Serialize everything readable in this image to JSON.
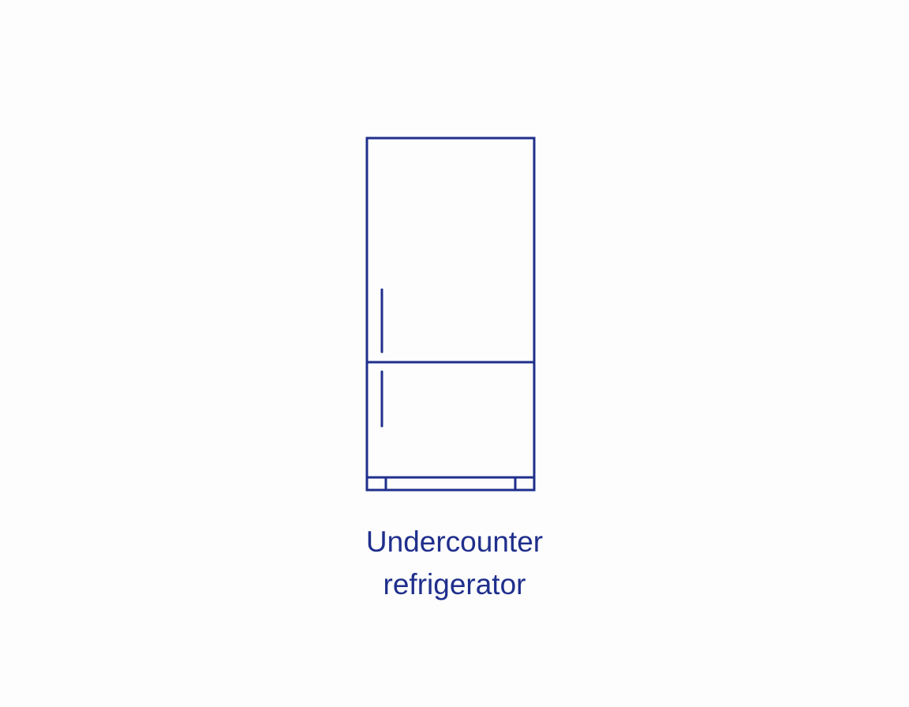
{
  "item": {
    "icon": "undercounter-refrigerator-icon",
    "label_line_1": "Undercounter",
    "label_line_2": "refrigerator"
  },
  "colors": {
    "line": "#1f2f8c",
    "background": "#fdfdfd"
  }
}
